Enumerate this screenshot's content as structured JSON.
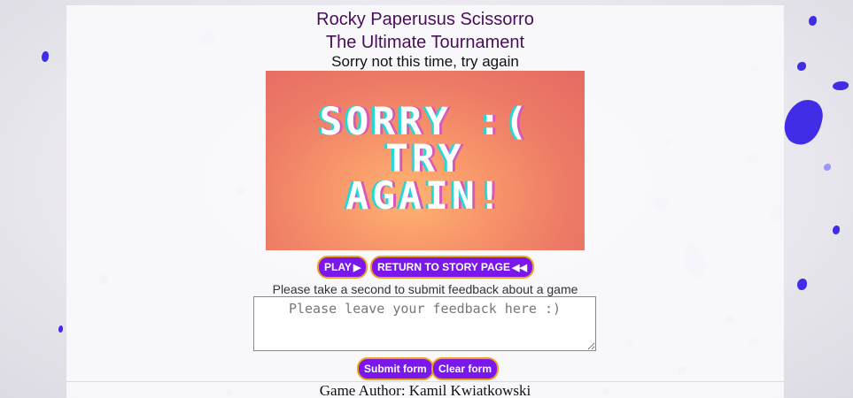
{
  "header": {
    "title_line1": "Rocky Paperusus Scissorro",
    "title_line2": "The Ultimate Tournament",
    "subtitle": "Sorry not this time, try again"
  },
  "hero": {
    "line1": "SORRY :(",
    "line2": "TRY",
    "line3": "AGAIN!"
  },
  "actions": {
    "play_label": "PLAY",
    "play_icon": "play-icon",
    "return_label": "RETURN TO STORY PAGE",
    "return_icon": "rewind-icon"
  },
  "feedback": {
    "label": "Please take a second to submit feedback about a game",
    "placeholder": "Please leave your feedback here :)",
    "value": "",
    "submit_label": "Submit form",
    "clear_label": "Clear form"
  },
  "footer": {
    "author": "Game Author: Kamil Kwiatkowski"
  },
  "colors": {
    "title": "#4a0d5a",
    "button_bg": "#7a17ea",
    "button_border": "#f0a020",
    "petal": "#8f8dff",
    "petal_dark": "#2f18e6"
  }
}
